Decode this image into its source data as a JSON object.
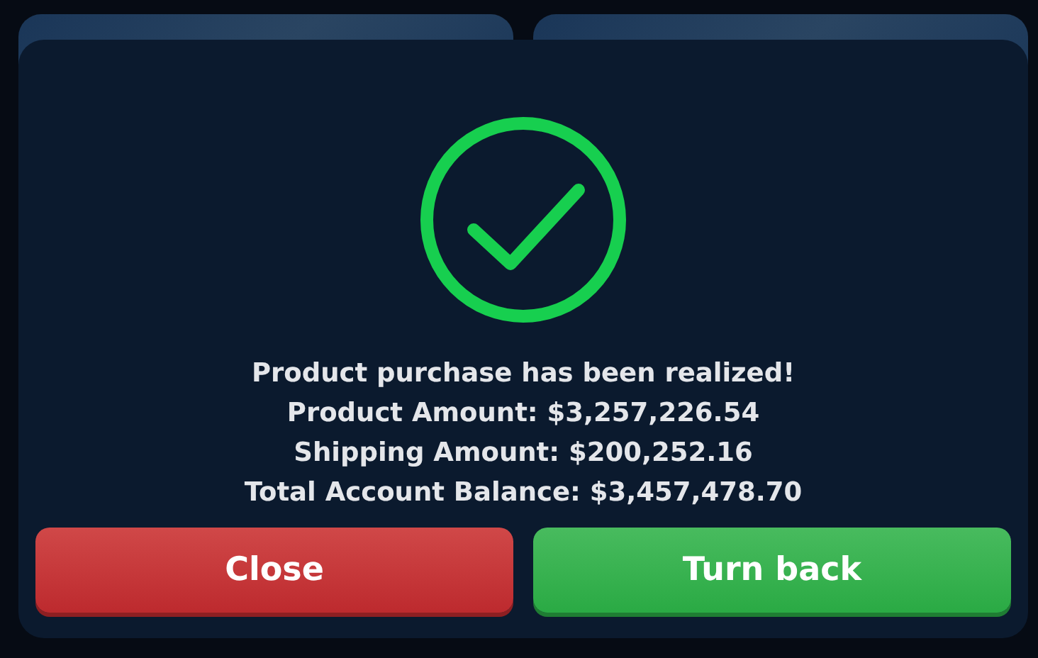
{
  "dialog": {
    "lines": [
      "Product purchase has been realized!",
      "Product Amount: $3,257,226.54",
      "Shipping Amount: $200,252.16",
      "Total Account Balance: $3,457,478.70"
    ],
    "buttons": [
      {
        "label": "Close",
        "kind": "danger"
      },
      {
        "label": "Turn back",
        "kind": "success"
      }
    ]
  }
}
